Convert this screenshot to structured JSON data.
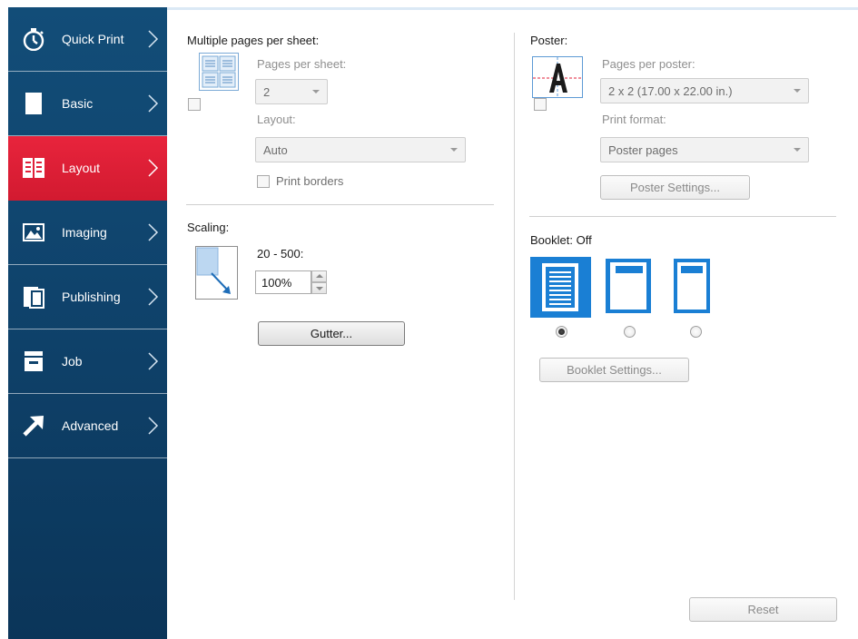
{
  "sidebar": {
    "items": [
      {
        "label": "Quick Print",
        "icon": "stopwatch-icon",
        "active": false
      },
      {
        "label": "Basic",
        "icon": "page-icon",
        "active": false
      },
      {
        "label": "Layout",
        "icon": "layout-grid-icon",
        "active": true
      },
      {
        "label": "Imaging",
        "icon": "image-icon",
        "active": false
      },
      {
        "label": "Publishing",
        "icon": "publishing-pages-icon",
        "active": false
      },
      {
        "label": "Job",
        "icon": "job-tray-icon",
        "active": false
      },
      {
        "label": "Advanced",
        "icon": "diagonal-arrow-icon",
        "active": false
      }
    ]
  },
  "multiple_pages": {
    "heading": "Multiple pages per sheet:",
    "pages_per_sheet_label": "Pages per sheet:",
    "pages_per_sheet_value": "2",
    "layout_label": "Layout:",
    "layout_value": "Auto",
    "print_borders_label": "Print borders",
    "enabled": false,
    "print_borders_checked": false
  },
  "scaling": {
    "heading": "Scaling:",
    "range_label": "20 - 500:",
    "value": "100%",
    "gutter_button": "Gutter..."
  },
  "poster": {
    "heading": "Poster:",
    "pages_per_poster_label": "Pages per poster:",
    "pages_per_poster_value": "2 x 2 (17.00 x 22.00 in.)",
    "print_format_label": "Print format:",
    "print_format_value": "Poster pages",
    "settings_button": "Poster Settings...",
    "enabled": false
  },
  "booklet": {
    "heading": "Booklet:",
    "status": "Off",
    "options_selected": 0,
    "settings_button": "Booklet Settings..."
  },
  "footer": {
    "reset_button": "Reset"
  },
  "colors": {
    "sidebar_bg": "#0f436c",
    "active_red": "#e0203a",
    "booklet_blue": "#1a7fd4"
  }
}
